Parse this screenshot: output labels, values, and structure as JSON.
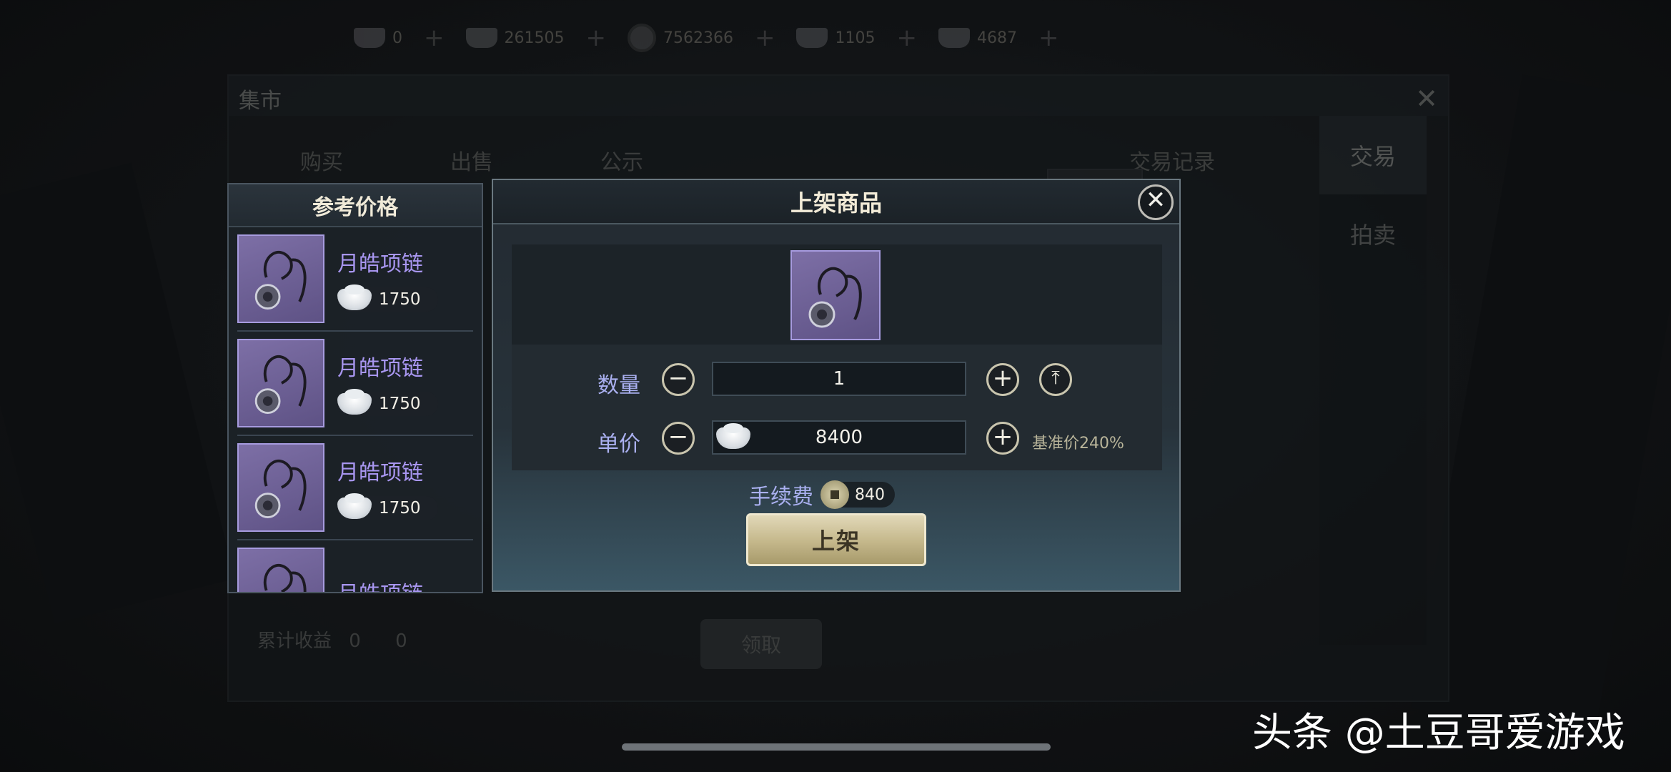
{
  "currencies": [
    {
      "icon": "ingot-icon",
      "value": "0"
    },
    {
      "icon": "ingot-icon",
      "value": "261505"
    },
    {
      "icon": "coin-icon",
      "value": "7562366"
    },
    {
      "icon": "ingot-icon",
      "value": "1105"
    },
    {
      "icon": "ingot-icon",
      "value": "4687"
    }
  ],
  "background_window": {
    "title": "集市",
    "tabs": [
      "购买",
      "出售",
      "公示"
    ],
    "record_label": "交易记录",
    "side_tabs": [
      "交易",
      "拍卖"
    ],
    "total_earnings_label": "累计收益",
    "earnings": [
      "0",
      "0"
    ],
    "collect_label": "领取"
  },
  "reference_panel": {
    "title": "参考价格",
    "items": [
      {
        "name": "月皓项链",
        "price": "1750"
      },
      {
        "name": "月皓项链",
        "price": "1750"
      },
      {
        "name": "月皓项链",
        "price": "1750"
      },
      {
        "name": "月皓项链",
        "price": ""
      }
    ]
  },
  "dialog": {
    "title": "上架商品",
    "quantity_label": "数量",
    "quantity_value": "1",
    "price_label": "单价",
    "price_value": "8400",
    "base_price_label": "基准价240%",
    "fee_label": "手续费",
    "fee_value": "840",
    "submit_label": "上架"
  },
  "watermark": "头条 @土豆哥爱游戏",
  "colors": {
    "accent_purple": "#a896f0",
    "label_blue": "#aab0f0",
    "gold_button": "#c4b78a"
  }
}
